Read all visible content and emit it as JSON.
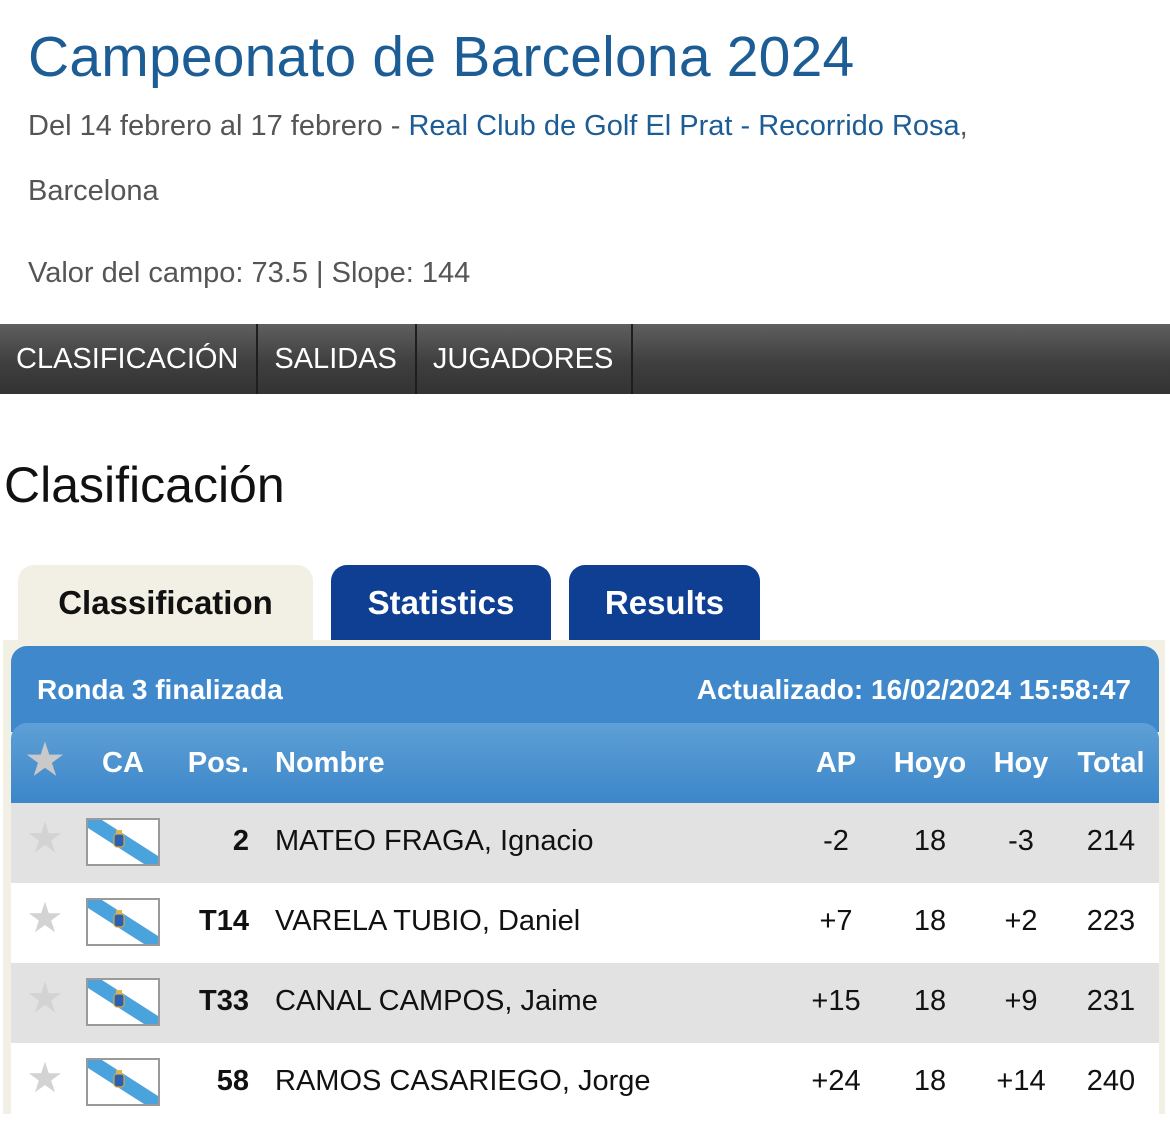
{
  "event": {
    "title": "Campeonato de Barcelona 2024",
    "dates": "Del 14 febrero al 17 febrero - ",
    "venue": "Real Club de Golf El Prat - Recorrido Rosa",
    "comma": ",",
    "city": "Barcelona",
    "course_info": "Valor del campo: 73.5 | Slope: 144"
  },
  "nav": {
    "items": [
      "CLASIFICACIÓN",
      "SALIDAS",
      "JUGADORES"
    ]
  },
  "section_heading": "Clasificación",
  "tabs": {
    "classification": "Classification",
    "statistics": "Statistics",
    "results": "Results"
  },
  "status": {
    "round": "Ronda 3 finalizada",
    "updated": "Actualizado: 16/02/2024 15:58:47"
  },
  "table": {
    "columns": {
      "star": "★",
      "ca": "CA",
      "pos": "Pos.",
      "name": "Nombre",
      "ap": "AP",
      "hoyo": "Hoyo",
      "hoy": "Hoy",
      "total": "Total"
    },
    "rows": [
      {
        "star": "★",
        "flag": "galicia-flag-icon",
        "pos": "2",
        "name": "MATEO FRAGA, Ignacio",
        "ap": "-2",
        "hoyo": "18",
        "hoy": "-3",
        "total": "214"
      },
      {
        "star": "★",
        "flag": "galicia-flag-icon",
        "pos": "T14",
        "name": "VARELA TUBIO, Daniel",
        "ap": "+7",
        "hoyo": "18",
        "hoy": "+2",
        "total": "223"
      },
      {
        "star": "★",
        "flag": "galicia-flag-icon",
        "pos": "T33",
        "name": "CANAL CAMPOS, Jaime",
        "ap": "+15",
        "hoyo": "18",
        "hoy": "+9",
        "total": "231"
      },
      {
        "star": "★",
        "flag": "galicia-flag-icon",
        "pos": "58",
        "name": "RAMOS CASARIEGO, Jorge",
        "ap": "+24",
        "hoyo": "18",
        "hoy": "+14",
        "total": "240"
      }
    ]
  },
  "colors": {
    "link_blue": "#1d5d95",
    "tab_blue": "#0e3f93",
    "header_blue": "#3f88cc",
    "flag_blue": "#4aa3dc"
  }
}
